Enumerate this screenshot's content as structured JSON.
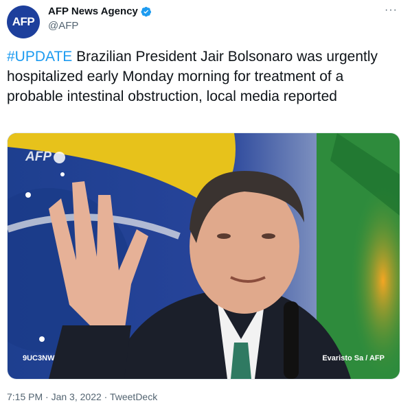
{
  "account": {
    "avatar_text": "AFP",
    "display_name": "AFP News Agency",
    "handle": "@AFP",
    "verified_icon": "verified-badge-icon",
    "more_label": "···"
  },
  "tweet": {
    "hashtag": "#UPDATE",
    "body": " Brazilian President Jair Bolsonaro was urgently hospitalized early Monday morning for treatment of a probable intestinal obstruction, local media reported"
  },
  "photo": {
    "watermark": "AFP",
    "photo_id": "9UC3NW",
    "credit": "Evaristo Sa / AFP"
  },
  "meta": {
    "time": "7:15 PM",
    "sep1": " · ",
    "date": "Jan 3, 2022",
    "sep2": " · ",
    "source": "TweetDeck"
  },
  "colors": {
    "accent": "#1d9bf0",
    "avatar_bg": "#1d3f9c",
    "secondary_text": "#536471"
  }
}
